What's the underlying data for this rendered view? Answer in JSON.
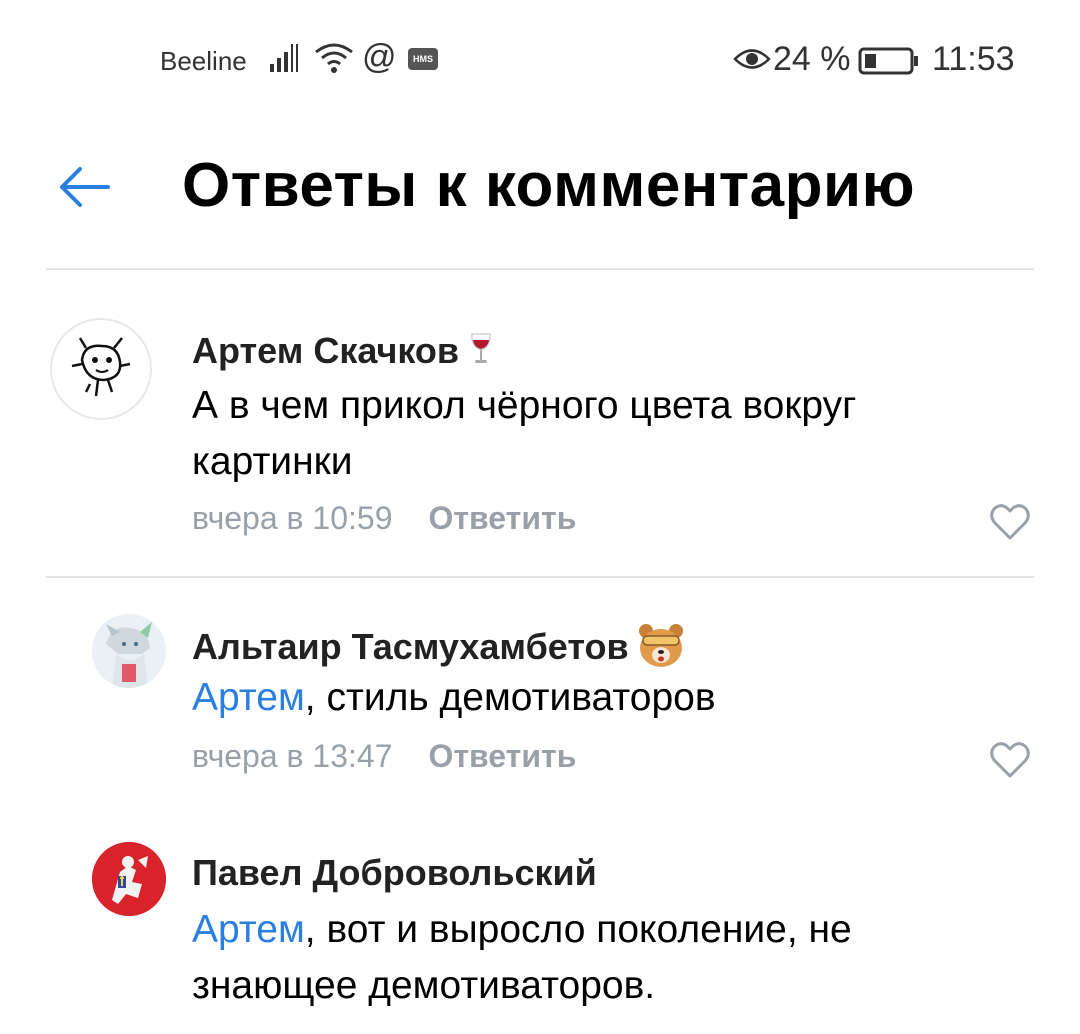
{
  "status_bar": {
    "carrier": "Beeline",
    "hms_badge": "HMS",
    "battery_percent": "24 %",
    "time": "11:53",
    "icons": [
      "signal-icon",
      "wifi-icon",
      "at-icon",
      "hms-icon",
      "eye-icon",
      "battery-icon"
    ]
  },
  "header": {
    "title": "Ответы к комментарию",
    "back_icon": "arrow-left-icon"
  },
  "colors": {
    "accent": "#2a7fe0",
    "meta": "#9aa0a8",
    "divider": "#e3e4e8"
  },
  "comments": [
    {
      "author": "Артем Скачков",
      "author_emoji": "wine-glass-emoji",
      "mention": "",
      "text": "А в чем прикол чёрного цвета вокруг картинки",
      "time": "вчера в 10:59",
      "reply_label": "Ответить"
    },
    {
      "author": "Альтаир Тасмухамбетов",
      "author_emoji": "bear-emoji",
      "mention": "Артем",
      "text": ", стиль демотиваторов",
      "time": "вчера в 13:47",
      "reply_label": "Ответить"
    },
    {
      "author": "Павел Добровольский",
      "author_emoji": "",
      "mention": "Артем",
      "text": ", вот и выросло поколение, не знающее демотиваторов.",
      "time": "",
      "reply_label": ""
    }
  ]
}
